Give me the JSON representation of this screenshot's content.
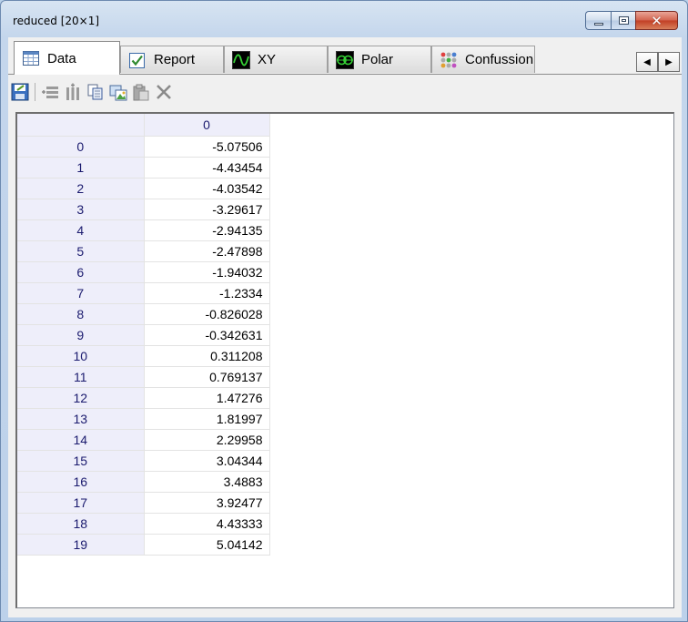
{
  "window": {
    "title": "reduced [20×1]",
    "controls": {
      "minimize": "minimize",
      "maximize": "maximize",
      "close": "✕"
    }
  },
  "tabs": [
    {
      "label": "Data",
      "icon": "table-icon",
      "active": true
    },
    {
      "label": "Report",
      "icon": "checkmark-icon",
      "active": false
    },
    {
      "label": "XY",
      "icon": "wave-icon",
      "active": false
    },
    {
      "label": "Polar",
      "icon": "polar-icon",
      "active": false
    },
    {
      "label": "Confussion",
      "icon": "dots-matrix-icon",
      "active": false
    }
  ],
  "tab_scroll": {
    "left": "◀",
    "right": "▶"
  },
  "toolbar": {
    "icons": [
      "save-icon",
      "insert-row-icon",
      "insert-column-icon",
      "copy-icon",
      "paste-image-icon",
      "paste-icon",
      "delete-icon"
    ]
  },
  "grid": {
    "column_header": "0",
    "rows": [
      {
        "index": "0",
        "value": "-5.07506"
      },
      {
        "index": "1",
        "value": "-4.43454"
      },
      {
        "index": "2",
        "value": "-4.03542"
      },
      {
        "index": "3",
        "value": "-3.29617"
      },
      {
        "index": "4",
        "value": "-2.94135"
      },
      {
        "index": "5",
        "value": "-2.47898"
      },
      {
        "index": "6",
        "value": "-1.94032"
      },
      {
        "index": "7",
        "value": "-1.2334"
      },
      {
        "index": "8",
        "value": "-0.826028"
      },
      {
        "index": "9",
        "value": "-0.342631"
      },
      {
        "index": "10",
        "value": "0.311208"
      },
      {
        "index": "11",
        "value": "0.769137"
      },
      {
        "index": "12",
        "value": "1.47276"
      },
      {
        "index": "13",
        "value": "1.81997"
      },
      {
        "index": "14",
        "value": "2.29958"
      },
      {
        "index": "15",
        "value": "3.04344"
      },
      {
        "index": "16",
        "value": "3.4883"
      },
      {
        "index": "17",
        "value": "3.92477"
      },
      {
        "index": "18",
        "value": "4.43333"
      },
      {
        "index": "19",
        "value": "5.04142"
      }
    ]
  },
  "colors": {
    "header_bg": "#eeeefa",
    "header_text": "#1a1a6e",
    "accent": "#2a63b0"
  }
}
